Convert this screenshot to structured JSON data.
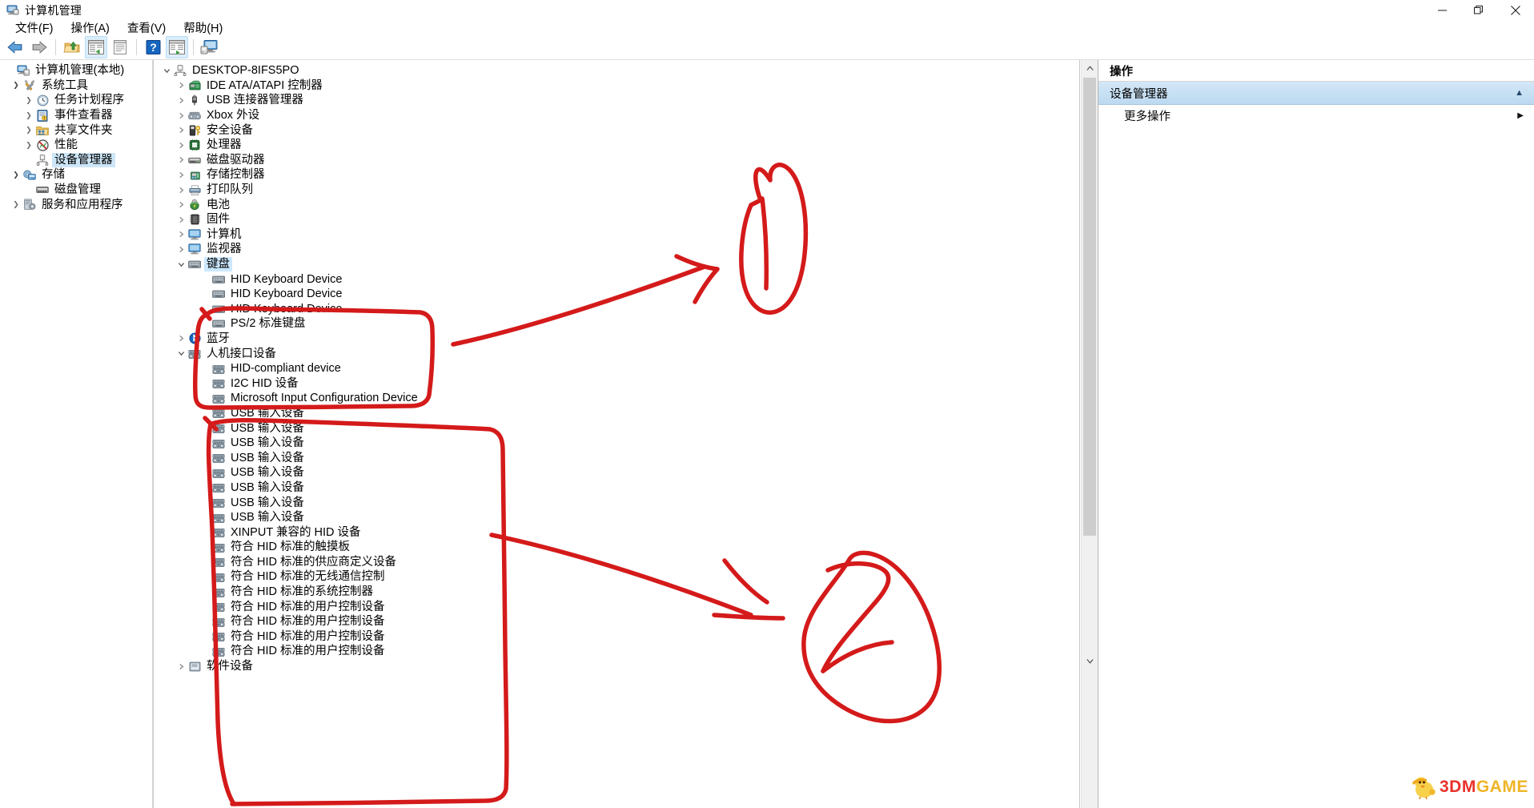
{
  "window": {
    "title": "计算机管理",
    "icon": "computer-management-icon",
    "buttons": {
      "minimize": "—",
      "restore": "❐",
      "close": "✕"
    }
  },
  "menubar": [
    {
      "name": "file",
      "label": "文件(F)"
    },
    {
      "name": "action",
      "label": "操作(A)"
    },
    {
      "name": "view",
      "label": "查看(V)"
    },
    {
      "name": "help",
      "label": "帮助(H)"
    }
  ],
  "toolbar": [
    {
      "name": "back-icon",
      "type": "arrow-back"
    },
    {
      "name": "forward-icon",
      "type": "arrow-forward"
    },
    {
      "name": "separator",
      "type": "sep"
    },
    {
      "name": "up-one-level-icon",
      "type": "folder-up"
    },
    {
      "name": "show-console-tree-icon",
      "type": "window-tree",
      "selected": true
    },
    {
      "name": "properties-icon",
      "type": "properties"
    },
    {
      "name": "separator",
      "type": "sep"
    },
    {
      "name": "help-icon",
      "type": "help"
    },
    {
      "name": "export-list-icon",
      "type": "window-play",
      "selected": true
    },
    {
      "name": "separator",
      "type": "sep"
    },
    {
      "name": "scan-hardware-icon",
      "type": "computer"
    }
  ],
  "console_tree": {
    "root": {
      "label": "计算机管理(本地)",
      "icon": "computer-icon",
      "level": 0,
      "twisty": ""
    },
    "items": [
      {
        "label": "系统工具",
        "icon": "tools-icon",
        "level": 1,
        "twisty": "open"
      },
      {
        "label": "任务计划程序",
        "icon": "clock-icon",
        "level": 2,
        "twisty": "closed"
      },
      {
        "label": "事件查看器",
        "icon": "eventlog-icon",
        "level": 2,
        "twisty": "closed"
      },
      {
        "label": "共享文件夹",
        "icon": "sharedfolder-icon",
        "level": 2,
        "twisty": "closed"
      },
      {
        "label": "性能",
        "icon": "performance-icon",
        "level": 2,
        "twisty": "closed"
      },
      {
        "label": "设备管理器",
        "icon": "devicemgr-icon",
        "level": 2,
        "twisty": "",
        "selected": true
      },
      {
        "label": "存储",
        "icon": "storage-icon",
        "level": 1,
        "twisty": "open"
      },
      {
        "label": "磁盘管理",
        "icon": "diskmgmt-icon",
        "level": 2,
        "twisty": ""
      },
      {
        "label": "服务和应用程序",
        "icon": "services-icon",
        "level": 1,
        "twisty": "closed"
      }
    ]
  },
  "device_tree": {
    "root": {
      "label": "DESKTOP-8IFS5PO",
      "icon": "computer-node-icon",
      "level": 0,
      "twisty": "open"
    },
    "items": [
      {
        "label": "IDE ATA/ATAPI 控制器",
        "icon": "ide-icon",
        "level": 1,
        "twisty": "closed"
      },
      {
        "label": "USB 连接器管理器",
        "icon": "usb-icon",
        "level": 1,
        "twisty": "closed"
      },
      {
        "label": "Xbox 外设",
        "icon": "xbox-icon",
        "level": 1,
        "twisty": "closed"
      },
      {
        "label": "安全设备",
        "icon": "security-icon",
        "level": 1,
        "twisty": "closed"
      },
      {
        "label": "处理器",
        "icon": "cpu-icon",
        "level": 1,
        "twisty": "closed"
      },
      {
        "label": "磁盘驱动器",
        "icon": "disk-icon",
        "level": 1,
        "twisty": "closed"
      },
      {
        "label": "存储控制器",
        "icon": "storagectrl-icon",
        "level": 1,
        "twisty": "closed"
      },
      {
        "label": "打印队列",
        "icon": "printer-icon",
        "level": 1,
        "twisty": "closed"
      },
      {
        "label": "电池",
        "icon": "battery-icon",
        "level": 1,
        "twisty": "closed"
      },
      {
        "label": "固件",
        "icon": "firmware-icon",
        "level": 1,
        "twisty": "closed"
      },
      {
        "label": "计算机",
        "icon": "monitor-icon",
        "level": 1,
        "twisty": "closed"
      },
      {
        "label": "监视器",
        "icon": "monitor-icon",
        "level": 1,
        "twisty": "closed"
      },
      {
        "label": "键盘",
        "icon": "keyboard-icon",
        "level": 1,
        "twisty": "open",
        "selected": true
      },
      {
        "label": "HID Keyboard Device",
        "icon": "keyboard-icon",
        "level": 2,
        "twisty": ""
      },
      {
        "label": "HID Keyboard Device",
        "icon": "keyboard-icon",
        "level": 2,
        "twisty": ""
      },
      {
        "label": "HID Keyboard Device",
        "icon": "keyboard-icon",
        "level": 2,
        "twisty": ""
      },
      {
        "label": "PS/2 标准键盘",
        "icon": "keyboard-icon",
        "level": 2,
        "twisty": ""
      },
      {
        "label": "蓝牙",
        "icon": "bluetooth-icon",
        "level": 1,
        "twisty": "closed"
      },
      {
        "label": "人机接口设备",
        "icon": "hid-icon",
        "level": 1,
        "twisty": "open"
      },
      {
        "label": "HID-compliant device",
        "icon": "hid-icon",
        "level": 2,
        "twisty": ""
      },
      {
        "label": "I2C HID 设备",
        "icon": "hid-icon",
        "level": 2,
        "twisty": ""
      },
      {
        "label": "Microsoft Input Configuration Device",
        "icon": "hid-icon",
        "level": 2,
        "twisty": ""
      },
      {
        "label": "USB 输入设备",
        "icon": "hid-icon",
        "level": 2,
        "twisty": ""
      },
      {
        "label": "USB 输入设备",
        "icon": "hid-icon",
        "level": 2,
        "twisty": ""
      },
      {
        "label": "USB 输入设备",
        "icon": "hid-icon",
        "level": 2,
        "twisty": ""
      },
      {
        "label": "USB 输入设备",
        "icon": "hid-icon",
        "level": 2,
        "twisty": ""
      },
      {
        "label": "USB 输入设备",
        "icon": "hid-icon",
        "level": 2,
        "twisty": ""
      },
      {
        "label": "USB 输入设备",
        "icon": "hid-icon",
        "level": 2,
        "twisty": ""
      },
      {
        "label": "USB 输入设备",
        "icon": "hid-icon",
        "level": 2,
        "twisty": ""
      },
      {
        "label": "USB 输入设备",
        "icon": "hid-icon",
        "level": 2,
        "twisty": ""
      },
      {
        "label": "XINPUT 兼容的 HID 设备",
        "icon": "hid-icon",
        "level": 2,
        "twisty": ""
      },
      {
        "label": "符合 HID 标准的触摸板",
        "icon": "hid-icon",
        "level": 2,
        "twisty": ""
      },
      {
        "label": "符合 HID 标准的供应商定义设备",
        "icon": "hid-icon",
        "level": 2,
        "twisty": ""
      },
      {
        "label": "符合 HID 标准的无线通信控制",
        "icon": "hid-icon",
        "level": 2,
        "twisty": ""
      },
      {
        "label": "符合 HID 标准的系统控制器",
        "icon": "hid-icon",
        "level": 2,
        "twisty": ""
      },
      {
        "label": "符合 HID 标准的用户控制设备",
        "icon": "hid-icon",
        "level": 2,
        "twisty": ""
      },
      {
        "label": "符合 HID 标准的用户控制设备",
        "icon": "hid-icon",
        "level": 2,
        "twisty": ""
      },
      {
        "label": "符合 HID 标准的用户控制设备",
        "icon": "hid-icon",
        "level": 2,
        "twisty": ""
      },
      {
        "label": "符合 HID 标准的用户控制设备",
        "icon": "hid-icon",
        "level": 2,
        "twisty": ""
      },
      {
        "label": "软件设备",
        "icon": "software-icon",
        "level": 1,
        "twisty": "closed"
      }
    ]
  },
  "actions_pane": {
    "header": "操作",
    "section": "设备管理器",
    "section_caret": "▲",
    "items": [
      {
        "label": "更多操作",
        "submenu_arrow": "▶"
      }
    ]
  },
  "annotations": {
    "color": "#d41a1a",
    "marks": [
      {
        "name": "annotation-circle-1",
        "text": "1"
      },
      {
        "name": "annotation-circle-2",
        "text": "2"
      }
    ]
  },
  "watermark": {
    "text_1": "3DM",
    "text_2": "GAME",
    "color_1": "#e8312a",
    "color_2": "#f0b429"
  },
  "scrollbar": {
    "up_arrow": "︿",
    "down_arrow": "﹀"
  }
}
